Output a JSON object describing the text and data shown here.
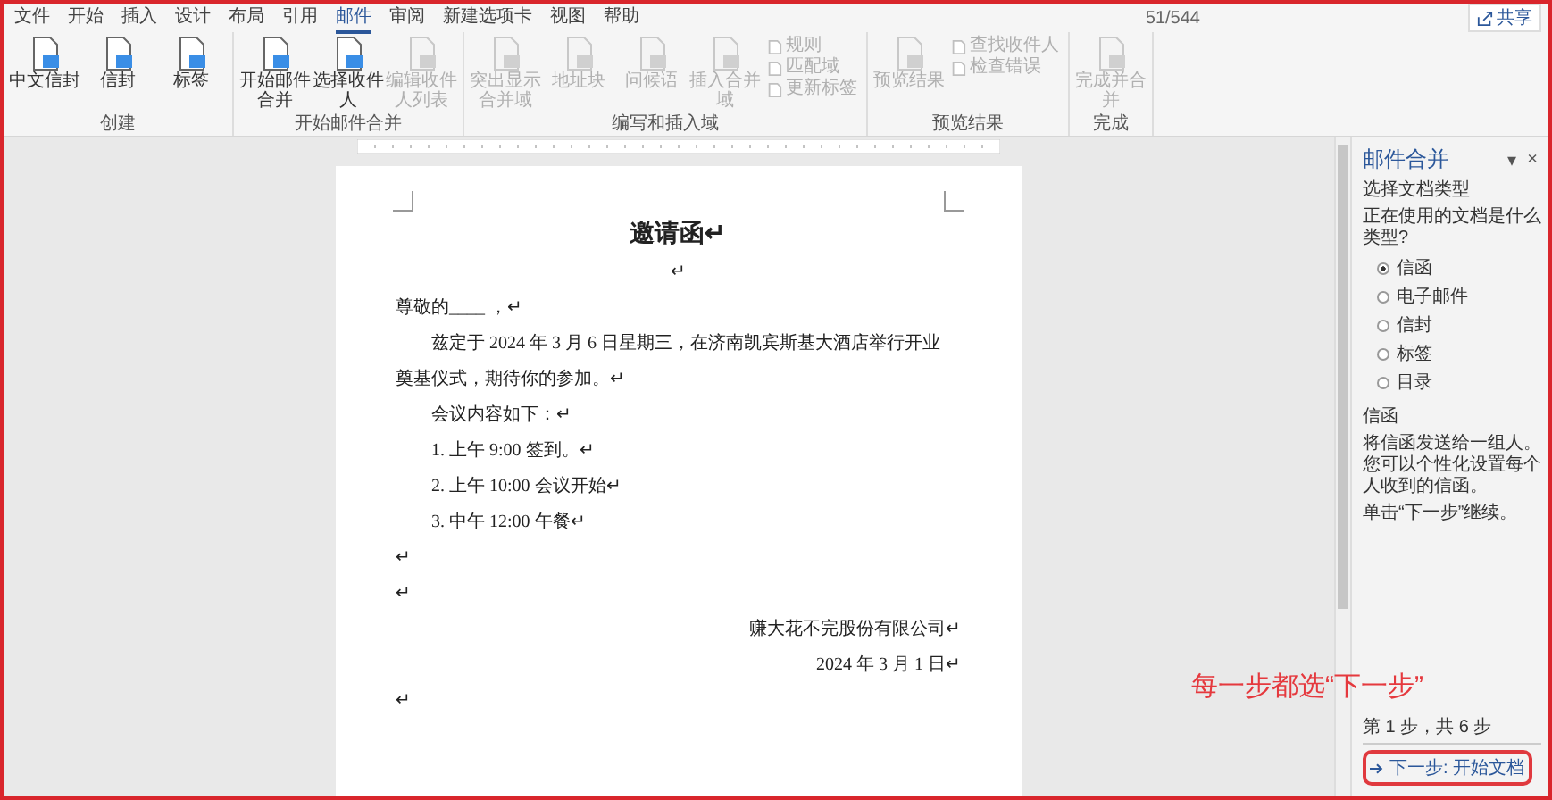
{
  "tabs": [
    {
      "label": "文件",
      "selected": false
    },
    {
      "label": "开始",
      "selected": false
    },
    {
      "label": "插入",
      "selected": false
    },
    {
      "label": "设计",
      "selected": false
    },
    {
      "label": "布局",
      "selected": false
    },
    {
      "label": "引用",
      "selected": false
    },
    {
      "label": "邮件",
      "selected": true
    },
    {
      "label": "审阅",
      "selected": false
    },
    {
      "label": "新建选项卡",
      "selected": false
    },
    {
      "label": "视图",
      "selected": false
    },
    {
      "label": "帮助",
      "selected": false
    }
  ],
  "page_counter": "51/544",
  "share_button": "共享",
  "ribbon_groups": [
    {
      "label": "创建",
      "items": [
        {
          "label": "中文信封",
          "kind": "large",
          "disabled": false
        },
        {
          "label": "信封",
          "kind": "large",
          "disabled": false
        },
        {
          "label": "标签",
          "kind": "large",
          "disabled": false
        }
      ]
    },
    {
      "label": "开始邮件合并",
      "items": [
        {
          "label": "开始邮件合并",
          "kind": "large",
          "disabled": false
        },
        {
          "label": "选择收件人",
          "kind": "large",
          "disabled": false
        },
        {
          "label": "编辑收件人列表",
          "kind": "large",
          "disabled": true
        }
      ]
    },
    {
      "label": "编写和插入域",
      "items": [
        {
          "label": "突出显示合并域",
          "kind": "large",
          "disabled": true
        },
        {
          "label": "地址块",
          "kind": "large",
          "disabled": true
        },
        {
          "label": "问候语",
          "kind": "large",
          "disabled": true
        },
        {
          "label": "插入合并域",
          "kind": "large",
          "disabled": true
        },
        {
          "label": "规则",
          "kind": "small",
          "disabled": true
        },
        {
          "label": "匹配域",
          "kind": "small",
          "disabled": true
        },
        {
          "label": "更新标签",
          "kind": "small",
          "disabled": true
        }
      ]
    },
    {
      "label": "预览结果",
      "items": [
        {
          "label": "预览结果",
          "kind": "large",
          "disabled": true
        },
        {
          "label": "查找收件人",
          "kind": "small",
          "disabled": true
        },
        {
          "label": "检查错误",
          "kind": "small",
          "disabled": true
        }
      ]
    },
    {
      "label": "完成",
      "items": [
        {
          "label": "完成并合并",
          "kind": "large",
          "disabled": true
        }
      ]
    }
  ],
  "document": {
    "paragraphs": [
      {
        "kind": "title",
        "text": "邀请函↵"
      },
      {
        "kind": "center",
        "text": "↵"
      },
      {
        "kind": "plain",
        "text": "尊敬的____ ，↵"
      },
      {
        "kind": "indent",
        "text": "兹定于 2024 年 3 月 6 日星期三，在济南凯宾斯基大酒店举行开业"
      },
      {
        "kind": "plain",
        "text": "奠基仪式，期待你的参加。↵"
      },
      {
        "kind": "indent",
        "text": "会议内容如下：↵"
      },
      {
        "kind": "indent",
        "text": "1. 上午 9:00 签到。↵"
      },
      {
        "kind": "indent",
        "text": "2. 上午 10:00 会议开始↵"
      },
      {
        "kind": "indent",
        "text": "3. 中午 12:00 午餐↵"
      },
      {
        "kind": "plain",
        "text": "↵"
      },
      {
        "kind": "plain",
        "text": "↵"
      },
      {
        "kind": "right",
        "text": "赚大花不完股份有限公司↵"
      },
      {
        "kind": "right",
        "text": "2024 年 3 月 1 日↵"
      },
      {
        "kind": "plain",
        "text": "↵"
      }
    ]
  },
  "pane": {
    "title": "邮件合并",
    "menu_glyph": "▾",
    "close_glyph": "×",
    "section_heading": "选择文档类型",
    "question": "正在使用的文档是什么类型?",
    "options": [
      {
        "label": "信函",
        "selected": true
      },
      {
        "label": "电子邮件",
        "selected": false
      },
      {
        "label": "信封",
        "selected": false
      },
      {
        "label": "标签",
        "selected": false
      },
      {
        "label": "目录",
        "selected": false
      }
    ],
    "description_heading": "信函",
    "description": "将信函发送给一组人。您可以个性化设置每个人收到的信函。",
    "instruction": "单击“下一步”继续。",
    "step": "第 1 步，共 6 步",
    "next_button": "下一步: 开始文档"
  },
  "annotation": "每一步都选“下一步”"
}
